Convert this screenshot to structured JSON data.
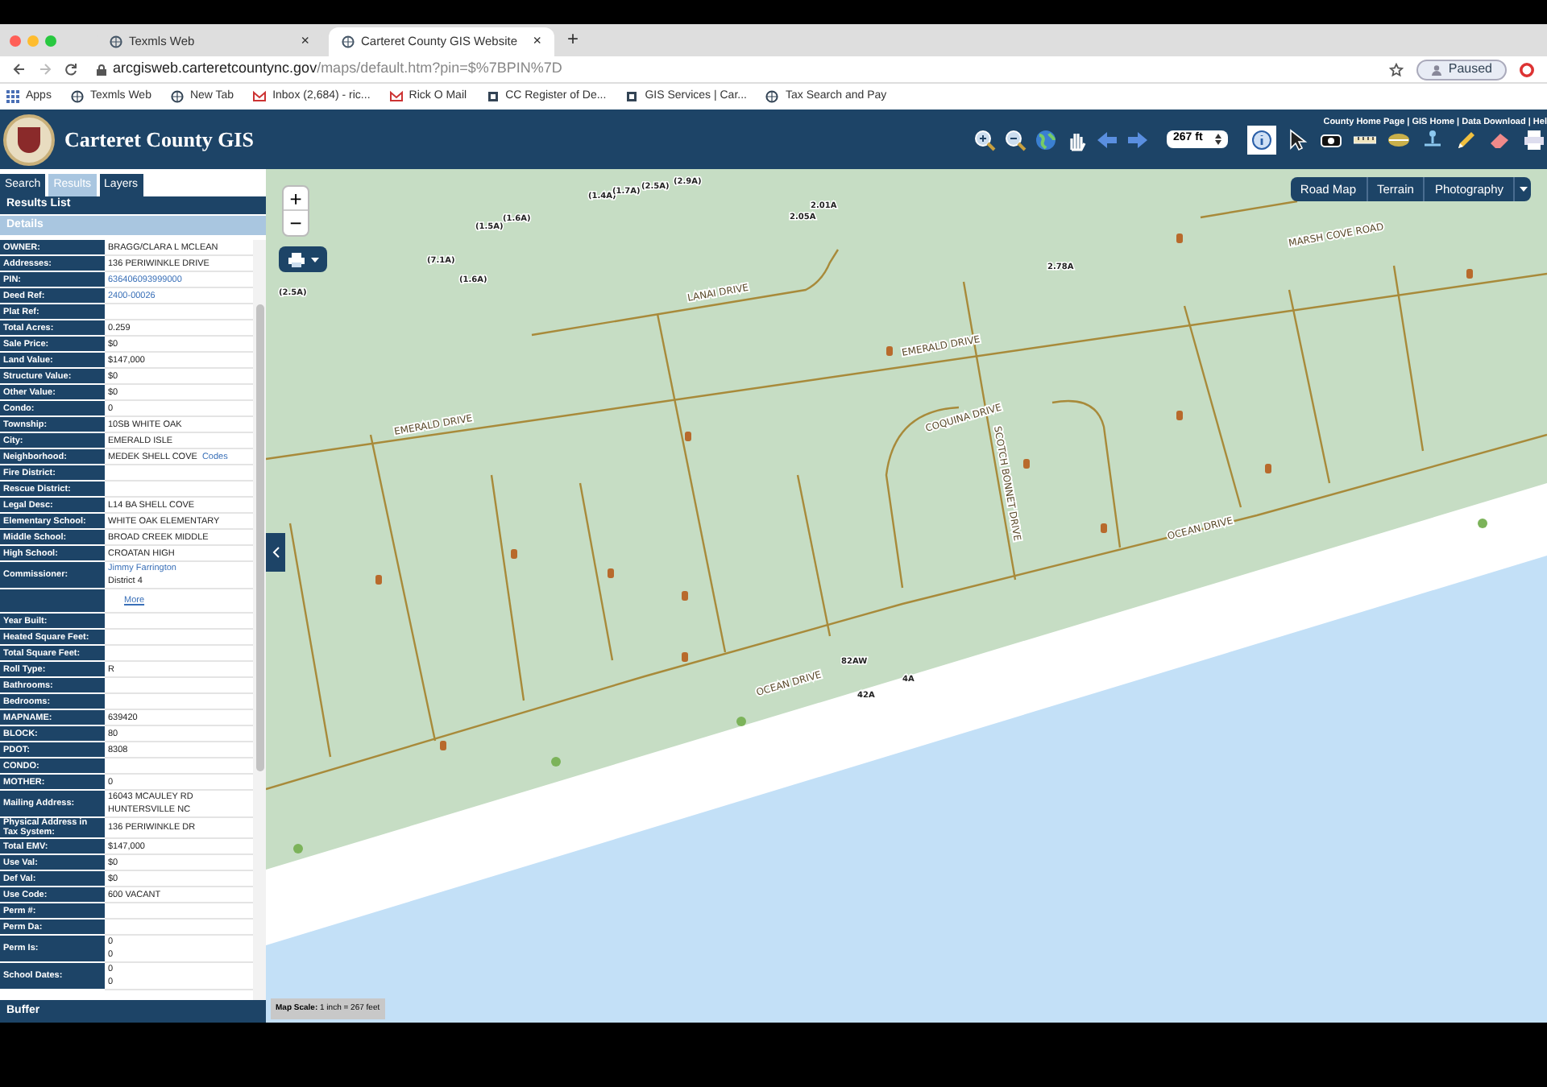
{
  "browser": {
    "tabs": [
      {
        "title": "Texmls Web",
        "close": "×",
        "selected": false
      },
      {
        "title": "Carteret County GIS Website",
        "close": "×",
        "selected": true
      }
    ],
    "new_tab": "+",
    "url_host": "arcgisweb.carteretcountync.gov",
    "url_path": "/maps/default.htm?pin=$%7BPIN%7D",
    "profile": "Paused",
    "bookmarks": [
      {
        "kind": "apps",
        "title": "Apps"
      },
      {
        "kind": "globe",
        "title": "Texmls Web"
      },
      {
        "kind": "globe",
        "title": "New Tab"
      },
      {
        "kind": "mail",
        "title": "Inbox (2,684) - ric..."
      },
      {
        "kind": "mail",
        "title": "Rick O Mail"
      },
      {
        "kind": "building",
        "title": "CC Register of De..."
      },
      {
        "kind": "building",
        "title": "GIS Services | Car..."
      },
      {
        "kind": "globe",
        "title": "Tax Search and Pay"
      }
    ]
  },
  "app": {
    "title": "Carteret County GIS",
    "header_links": "County Home Page | GIS Home | Data Download | Hel",
    "tools_left": [
      {
        "kind": "zoom-in",
        "selected": false
      },
      {
        "kind": "zoom-out",
        "selected": false
      },
      {
        "kind": "globe",
        "selected": false
      },
      {
        "kind": "hand",
        "selected": false
      },
      {
        "kind": "back",
        "selected": false
      },
      {
        "kind": "forward",
        "selected": false
      }
    ],
    "scale_select": "267 ft",
    "tools_right": [
      {
        "kind": "info",
        "selected": true
      },
      {
        "kind": "pointer",
        "selected": false
      },
      {
        "kind": "camera",
        "selected": false
      },
      {
        "kind": "measure",
        "selected": false
      },
      {
        "kind": "area",
        "selected": false
      },
      {
        "kind": "network",
        "selected": false
      },
      {
        "kind": "pencil",
        "selected": false
      },
      {
        "kind": "eraser",
        "selected": false
      },
      {
        "kind": "printer",
        "selected": false
      }
    ]
  },
  "panel": {
    "tabs": [
      {
        "label": "Search",
        "selected": false
      },
      {
        "label": "Results",
        "selected": true
      },
      {
        "label": "Layers",
        "selected": false
      }
    ],
    "results_list": "Results List",
    "details": "Details",
    "rows": [
      {
        "kind": "text",
        "label": "OWNER:",
        "value": "BRAGG/CLARA L MCLEAN"
      },
      {
        "kind": "text",
        "label": "Addresses:",
        "value": "136 PERIWINKLE DRIVE"
      },
      {
        "kind": "link",
        "label": "PIN:",
        "value": "636406093999000"
      },
      {
        "kind": "link",
        "label": "Deed Ref:",
        "value": "2400-00026"
      },
      {
        "kind": "text",
        "label": "Plat Ref:"
      },
      {
        "kind": "text",
        "label": "Total Acres:",
        "value": "0.259"
      },
      {
        "kind": "text",
        "label": "Sale Price:",
        "value": "$0"
      },
      {
        "kind": "text",
        "label": "Land Value:",
        "value": "$147,000"
      },
      {
        "kind": "text",
        "label": "Structure Value:",
        "value": "$0"
      },
      {
        "kind": "text",
        "label": "Other Value:",
        "value": "$0"
      },
      {
        "kind": "text",
        "label": "Condo:",
        "value": "0"
      },
      {
        "kind": "text",
        "label": "Township:",
        "value": "10SB WHITE OAK"
      },
      {
        "kind": "text",
        "label": "City:",
        "value": "EMERALD ISLE"
      },
      {
        "kind": "text",
        "label": "Neighborhood:",
        "value": "MEDEK SHELL COVE",
        "link": "Codes"
      },
      {
        "kind": "text",
        "label": "Fire District:"
      },
      {
        "kind": "text",
        "label": "Rescue District:"
      },
      {
        "kind": "text",
        "label": "Legal Desc:",
        "value": "L14 BA SHELL COVE"
      },
      {
        "kind": "text",
        "label": "Elementary School:",
        "value": "WHITE OAK ELEMENTARY"
      },
      {
        "kind": "text",
        "label": "Middle School:",
        "value": "BROAD CREEK MIDDLE"
      },
      {
        "kind": "text",
        "label": "High School:",
        "value": "CROATAN HIGH"
      },
      {
        "kind": "link",
        "label": "Commissioner:",
        "value": "Jimmy Farrington",
        "value_2": "District 4"
      },
      {
        "kind": "more",
        "value": "More"
      },
      {
        "kind": "text",
        "label": "Year Built:"
      },
      {
        "kind": "text",
        "label": "Heated Square Feet:"
      },
      {
        "kind": "text",
        "label": "Total Square Feet:"
      },
      {
        "kind": "text",
        "label": "Roll Type:",
        "value": "R"
      },
      {
        "kind": "text",
        "label": "Bathrooms:"
      },
      {
        "kind": "text",
        "label": "Bedrooms:"
      },
      {
        "kind": "text",
        "label": "MAPNAME:",
        "value": "639420"
      },
      {
        "kind": "text",
        "label": "BLOCK:",
        "value": "80"
      },
      {
        "kind": "text",
        "label": "PDOT:",
        "value": "8308"
      },
      {
        "kind": "text",
        "label": "CONDO:"
      },
      {
        "kind": "text",
        "label": "MOTHER:",
        "value": "0"
      },
      {
        "kind": "text",
        "label": "Mailing Address:",
        "value": "16043 MCAULEY RD",
        "value_2": "HUNTERSVILLE NC"
      },
      {
        "kind": "text",
        "label": "Physical Address in Tax System:",
        "value": "136 PERIWINKLE DR"
      },
      {
        "kind": "text",
        "label": "Total EMV:",
        "value": "$147,000"
      },
      {
        "kind": "text",
        "label": "Use Val:",
        "value": "$0"
      },
      {
        "kind": "text",
        "label": "Def Val:",
        "value": "$0"
      },
      {
        "kind": "text",
        "label": "Use Code:",
        "value": "600 VACANT"
      },
      {
        "kind": "text",
        "label": "Perm #:"
      },
      {
        "kind": "text",
        "label": "Perm Da:"
      },
      {
        "kind": "text",
        "label": "Perm Is:",
        "value": "0",
        "value_2": "0"
      },
      {
        "kind": "text",
        "label": "School Dates:",
        "value": "0",
        "value_2": "0"
      }
    ],
    "buffer": "Buffer"
  },
  "map": {
    "zoom_in": "+",
    "zoom_out": "−",
    "basemaps": [
      "Road Map",
      "Terrain",
      "Photography"
    ],
    "street_labels": [
      "LANAI DRIVE",
      "EMERALD DRIVE",
      "EMERALD DRIVE",
      "COQUINA DRIVE",
      "SCOTCH BONNET DRIVE",
      "OCEAN DRIVE",
      "OCEAN DRIVE",
      "MARSH COVE ROAD"
    ],
    "lot_labels": [
      "(1.5A)",
      "(1.6A)",
      "(1.4A)",
      "(1.7A)",
      "(2.5A)",
      "(2.9A)",
      "2.05A",
      "2.01A",
      "(7.1A)",
      "(1.6A)",
      "2.78A",
      "(2.5A)",
      "82AW",
      "4A",
      "42A"
    ],
    "scale_text": "**Map Scale:** 1 inch = 267 feet"
  }
}
